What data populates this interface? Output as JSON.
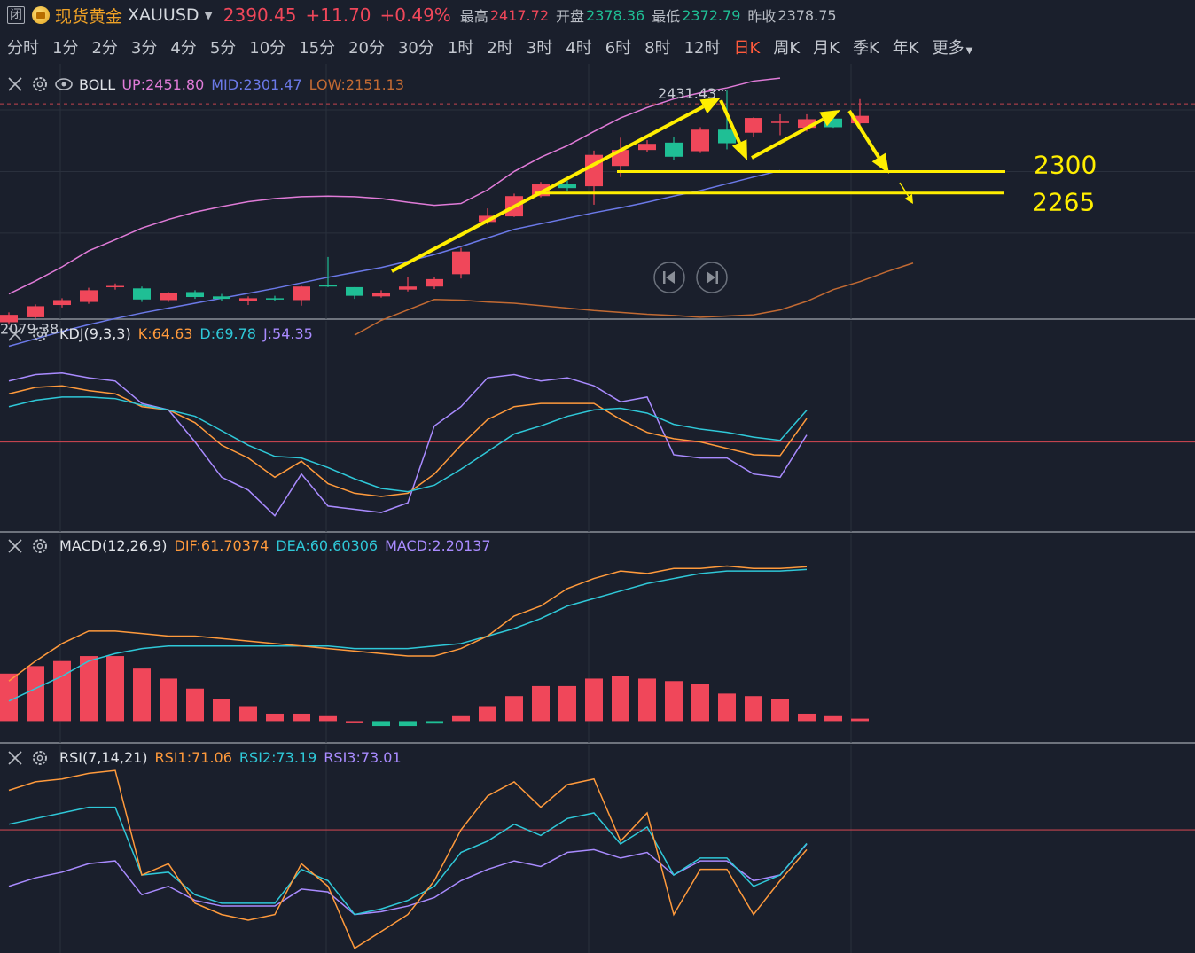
{
  "header": {
    "status_badge": "闭",
    "name": "现货黄金",
    "symbol": "XAUUSD",
    "price": "2390.45",
    "change": "+11.70",
    "change_pct": "+0.49%",
    "high_label": "最高",
    "high": "2417.72",
    "open_label": "开盘",
    "open": "2378.36",
    "low_label": "最低",
    "low": "2372.79",
    "prev_label": "昨收",
    "prev_close": "2378.75",
    "up_color": "#f0475a",
    "down_color": "#1fbf95"
  },
  "period_tabs": [
    "分时",
    "1分",
    "2分",
    "3分",
    "4分",
    "5分",
    "10分",
    "15分",
    "20分",
    "30分",
    "1时",
    "2时",
    "3时",
    "4时",
    "6时",
    "8时",
    "12时",
    "日K",
    "周K",
    "月K",
    "季K",
    "年K",
    "更多"
  ],
  "active_tab": "日K",
  "chart_data": [
    {
      "type": "candlestick",
      "indicator": "BOLL",
      "legend": {
        "name": "BOLL",
        "up": "UP:2451.80",
        "mid": "MID:2301.47",
        "low": "LOW:2151.13"
      },
      "price_range": [
        2060,
        2475
      ],
      "candles": [
        {
          "o": 2055,
          "c": 2067,
          "h": 2071,
          "l": 2051
        },
        {
          "o": 2063,
          "c": 2081,
          "h": 2084,
          "l": 2060
        },
        {
          "o": 2083,
          "c": 2091,
          "h": 2094,
          "l": 2079
        },
        {
          "o": 2088,
          "c": 2107,
          "h": 2111,
          "l": 2085
        },
        {
          "o": 2112,
          "c": 2114,
          "h": 2118,
          "l": 2108
        },
        {
          "o": 2110,
          "c": 2092,
          "h": 2113,
          "l": 2088
        },
        {
          "o": 2091,
          "c": 2102,
          "h": 2104,
          "l": 2088
        },
        {
          "o": 2104,
          "c": 2096,
          "h": 2107,
          "l": 2093
        },
        {
          "o": 2097,
          "c": 2093,
          "h": 2101,
          "l": 2090
        },
        {
          "o": 2089,
          "c": 2094,
          "h": 2097,
          "l": 2083
        },
        {
          "o": 2094,
          "c": 2093,
          "h": 2098,
          "l": 2089
        },
        {
          "o": 2091,
          "c": 2113,
          "h": 2114,
          "l": 2082
        },
        {
          "o": 2116,
          "c": 2113,
          "h": 2161,
          "l": 2112
        },
        {
          "o": 2112,
          "c": 2098,
          "h": 2112,
          "l": 2093
        },
        {
          "o": 2097,
          "c": 2102,
          "h": 2107,
          "l": 2095
        },
        {
          "o": 2108,
          "c": 2113,
          "h": 2128,
          "l": 2105
        },
        {
          "o": 2113,
          "c": 2125,
          "h": 2129,
          "l": 2109
        },
        {
          "o": 2133,
          "c": 2170,
          "h": 2176,
          "l": 2126
        },
        {
          "o": 2218,
          "c": 2228,
          "h": 2240,
          "l": 2214
        },
        {
          "o": 2227,
          "c": 2260,
          "h": 2264,
          "l": 2226
        },
        {
          "o": 2260,
          "c": 2279,
          "h": 2283,
          "l": 2258
        },
        {
          "o": 2279,
          "c": 2273,
          "h": 2285,
          "l": 2269
        },
        {
          "o": 2276,
          "c": 2327,
          "h": 2334,
          "l": 2246
        },
        {
          "o": 2309,
          "c": 2335,
          "h": 2355,
          "l": 2291
        },
        {
          "o": 2335,
          "c": 2345,
          "h": 2351,
          "l": 2331
        },
        {
          "o": 2347,
          "c": 2324,
          "h": 2356,
          "l": 2319
        },
        {
          "o": 2333,
          "c": 2368,
          "h": 2372,
          "l": 2330
        },
        {
          "o": 2368,
          "c": 2346,
          "h": 2431.43,
          "l": 2336
        },
        {
          "o": 2363,
          "c": 2387,
          "h": 2388,
          "l": 2356
        },
        {
          "o": 2381,
          "c": 2381,
          "h": 2393,
          "l": 2359
        },
        {
          "o": 2371,
          "c": 2385,
          "h": 2393,
          "l": 2365
        },
        {
          "o": 2386,
          "c": 2372,
          "h": 2390,
          "l": 2371
        },
        {
          "o": 2378.36,
          "c": 2390.45,
          "h": 2417.72,
          "l": 2372.79
        }
      ],
      "boll_up": [
        2101,
        2122,
        2145,
        2171,
        2189,
        2208,
        2222,
        2234,
        2243,
        2251,
        2256,
        2259,
        2260,
        2259,
        2256,
        2250,
        2245,
        2248,
        2270,
        2300,
        2323,
        2342,
        2365,
        2387,
        2404,
        2418,
        2428,
        2436,
        2447,
        2451.8
      ],
      "boll_mid": [
        2016,
        2028,
        2040,
        2051,
        2061,
        2070,
        2078,
        2086,
        2094,
        2102,
        2110,
        2119,
        2128,
        2136,
        2144,
        2154,
        2165,
        2178,
        2192,
        2206,
        2215,
        2224,
        2233,
        2241,
        2250,
        2260,
        2269,
        2280,
        2291,
        2301.47
      ],
      "boll_low_start_index": 13,
      "boll_low": [
        2034,
        2058,
        2075,
        2092,
        2091,
        2088,
        2086,
        2082,
        2078,
        2074,
        2071,
        2068,
        2066,
        2063,
        2065,
        2067,
        2075,
        2089,
        2108,
        2121,
        2137,
        2151.13
      ],
      "price_labels": {
        "high_mark": "2431.43",
        "low_mark": "2079.38",
        "low_mark_value": 2079.38
      },
      "ref_line": 2410,
      "annotations": [
        {
          "label": "2300",
          "value": 2300
        },
        {
          "label": "2265",
          "value": 2265
        }
      ]
    },
    {
      "type": "line",
      "indicator": "KDJ",
      "legend": {
        "name": "KDJ(9,3,3)",
        "k": "K:64.63",
        "d": "D:69.78",
        "j": "J:54.35"
      },
      "y_range": [
        -5,
        110
      ],
      "ref_line": 50,
      "k": [
        80,
        84,
        85,
        82,
        80,
        72,
        70,
        62,
        48,
        40,
        28,
        38,
        24,
        18,
        16,
        18,
        30,
        48,
        64,
        72,
        74,
        74,
        74,
        64,
        56,
        52,
        50,
        46,
        42,
        41.5,
        64.63
      ],
      "d": [
        72,
        76,
        78,
        78,
        77,
        73,
        70,
        66,
        57,
        48,
        41,
        40,
        34,
        27,
        21,
        19,
        23,
        33,
        44,
        55,
        60,
        66,
        70,
        71,
        68,
        61,
        58,
        56,
        53,
        51,
        69.78
      ],
      "j": [
        88,
        92,
        93,
        90,
        88,
        74,
        70,
        50,
        28,
        20,
        4,
        30,
        10,
        8,
        6,
        12,
        60,
        72,
        90,
        92,
        88,
        90,
        85,
        75,
        78,
        42,
        40,
        40,
        30,
        28,
        54.35
      ],
      "k_color": "#ff9a3c",
      "d_color": "#2fc8d8",
      "j_color": "#a98bff"
    },
    {
      "type": "bar",
      "indicator": "MACD",
      "legend": {
        "name": "MACD(12,26,9)",
        "dif": "DIF:61.70374",
        "dea": "DEA:60.60306",
        "macd": "MACD:2.20137"
      },
      "y_range": [
        -8,
        65
      ],
      "hist": [
        19,
        22,
        24,
        26,
        26,
        21,
        17,
        13,
        9,
        6,
        3,
        3,
        2,
        0,
        -2,
        -2,
        -1,
        2,
        6,
        10,
        14,
        14,
        17,
        18,
        17,
        16,
        15,
        11,
        10,
        9,
        3,
        2,
        1
      ],
      "dif": [
        16,
        24,
        31,
        36,
        36,
        35,
        34,
        34,
        33,
        32,
        31,
        30,
        29,
        28,
        27,
        26,
        26,
        29,
        34,
        42,
        46,
        53,
        57,
        60,
        59,
        61,
        61,
        62,
        61,
        61,
        61.7
      ],
      "dea": [
        8,
        13,
        18,
        24,
        27,
        29,
        30,
        30,
        30,
        30,
        30,
        30,
        30,
        29,
        29,
        29,
        30,
        31,
        34,
        37,
        41,
        46,
        49,
        52,
        55,
        57,
        59,
        60,
        60,
        60,
        60.6
      ],
      "dif_color": "#ff9a3c",
      "dea_color": "#2fc8d8"
    },
    {
      "type": "line",
      "indicator": "RSI",
      "legend": {
        "name": "RSI(7,14,21)",
        "rsi1": "RSI1:71.06",
        "rsi2": "RSI2:73.19",
        "rsi3": "RSI3:73.01"
      },
      "y_range": [
        35,
        100
      ],
      "ref_line": 78,
      "rsi1": [
        92,
        95,
        96,
        98,
        99,
        62,
        66,
        52,
        48,
        46,
        48,
        66,
        58,
        36,
        42,
        48,
        60,
        78,
        90,
        95,
        86,
        94,
        96,
        74,
        84,
        48,
        64,
        64,
        48,
        60,
        71
      ],
      "rsi2": [
        80,
        82,
        84,
        86,
        86,
        62,
        63,
        55,
        52,
        52,
        52,
        64,
        60,
        48,
        50,
        53,
        58,
        70,
        74,
        80,
        76,
        82,
        84,
        73,
        79,
        62,
        68,
        68,
        58,
        62,
        73.2
      ],
      "rsi3": [
        58,
        61,
        63,
        66,
        67,
        55,
        58,
        53,
        51,
        51,
        51,
        57,
        56,
        48,
        49,
        51,
        54,
        60,
        64,
        67,
        65,
        70,
        71,
        68,
        70,
        62,
        67,
        67,
        60,
        62,
        73
      ],
      "rsi1_color": "#ff9a3c",
      "rsi2_color": "#2fc8d8",
      "rsi3_color": "#a98bff"
    }
  ]
}
